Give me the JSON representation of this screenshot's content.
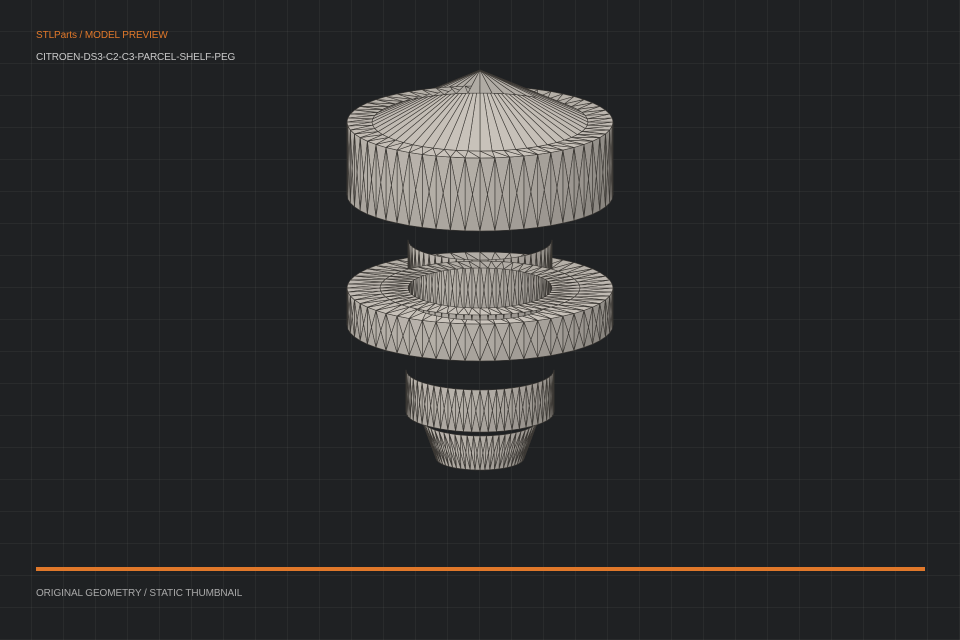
{
  "header": {
    "breadcrumb": "STLParts / MODEL PREVIEW",
    "model_name": "CITROEN-DS3-C2-C3-PARCEL-SHELF-PEG"
  },
  "viewport": {
    "model_icon": "mesh-wireframe-icon",
    "mesh_fill": "#8f8a84",
    "mesh_edge": "#3a3733"
  },
  "accent_color": "#e0782a",
  "footer": {
    "label": "ORIGINAL GEOMETRY / STATIC THUMBNAIL"
  }
}
